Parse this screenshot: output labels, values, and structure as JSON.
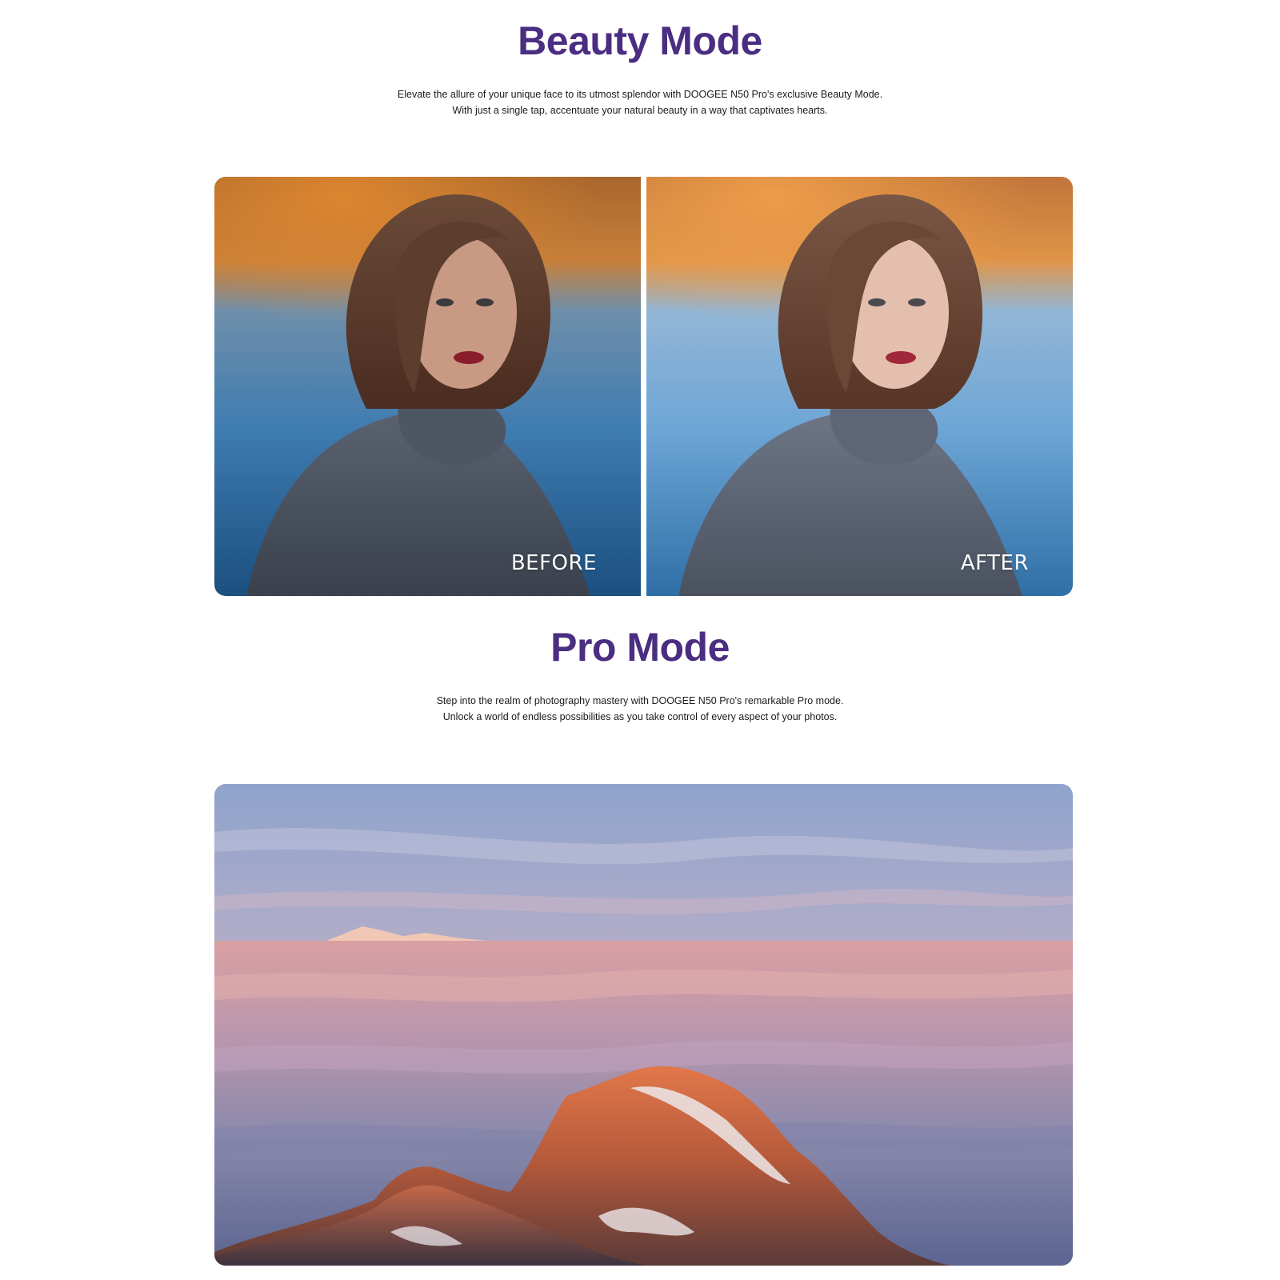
{
  "theme": {
    "title_color": "#4b2d82"
  },
  "beauty": {
    "title": "Beauty Mode",
    "line1": "Elevate the allure of your unique face to its utmost splendor with DOOGEE N50 Pro's exclusive Beauty Mode.",
    "line2": "With just a single tap, accentuate your natural beauty in a way that captivates hearts.",
    "before_label": "BEFORE",
    "after_label": "AFTER"
  },
  "pro": {
    "title": "Pro Mode",
    "line1": "Step into the realm of photography mastery with DOOGEE N50 Pro's remarkable Pro mode.",
    "line2": "Unlock a world of endless possibilities as you take control of every aspect of your photos."
  }
}
